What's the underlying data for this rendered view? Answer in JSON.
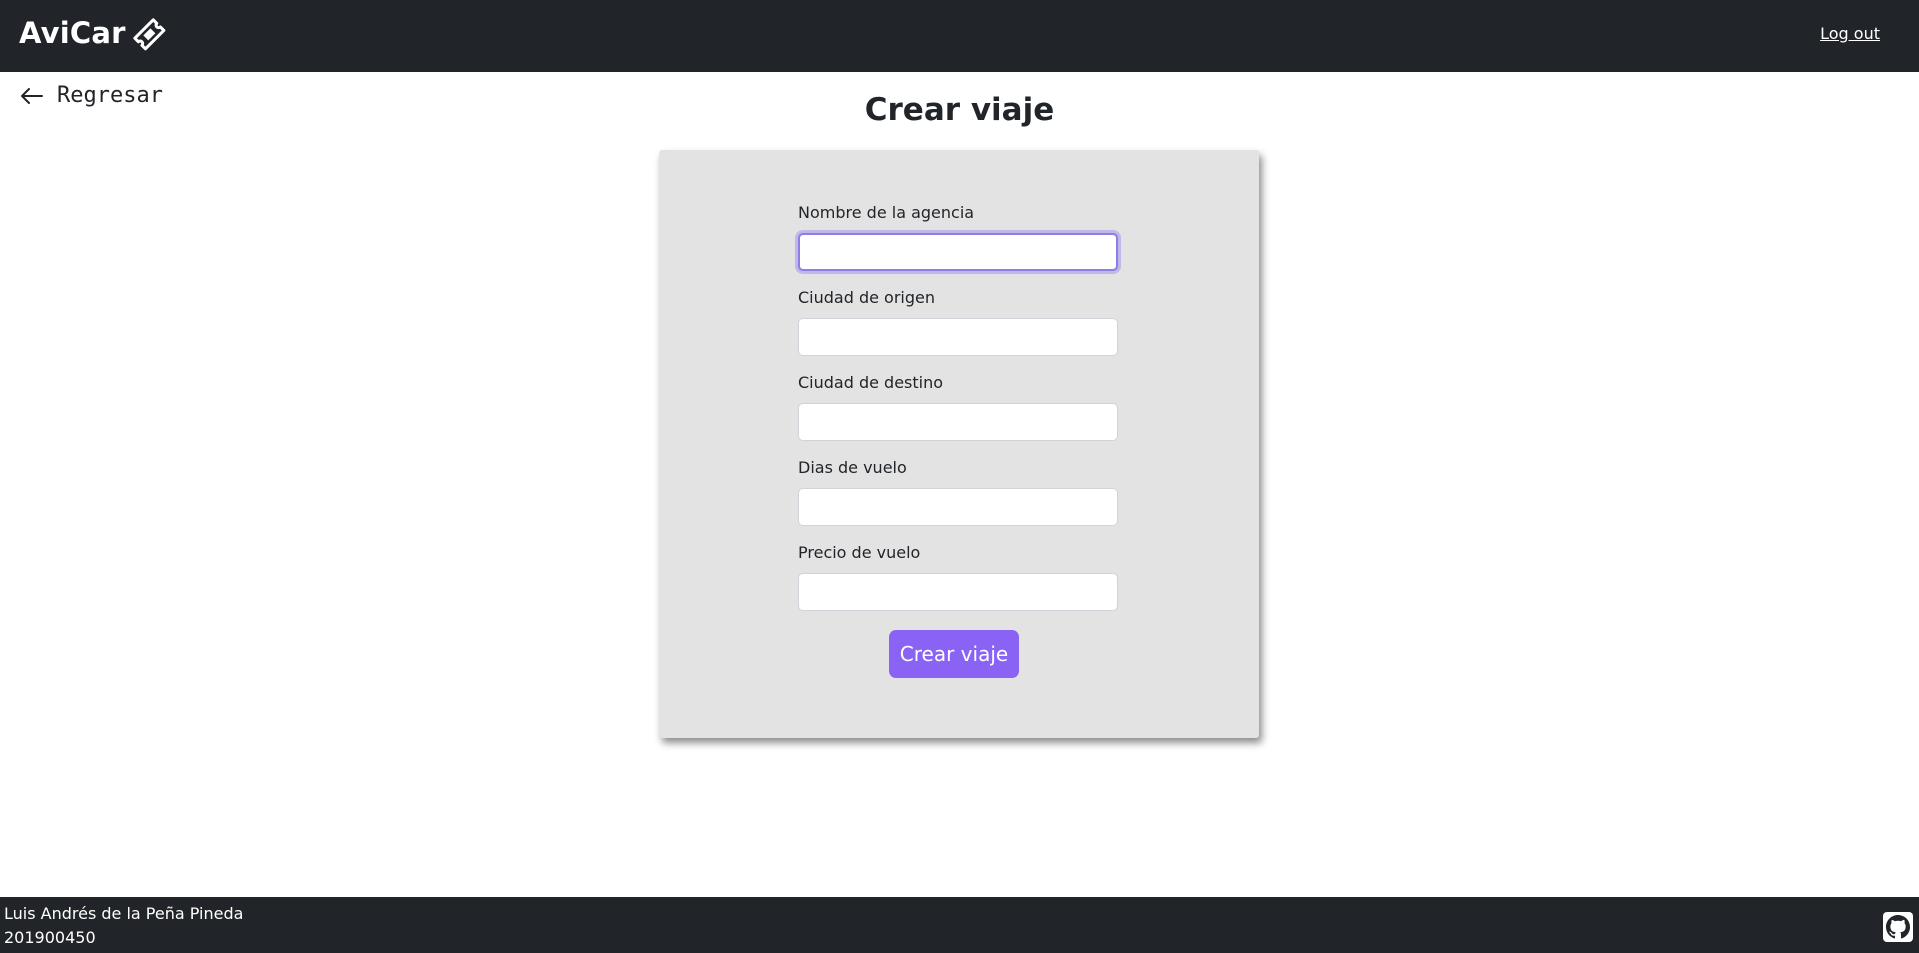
{
  "navbar": {
    "brand": "AviCar",
    "brand_icon": "ticket-icon",
    "logout_label": "Log out"
  },
  "back": {
    "icon": "arrow-left-icon",
    "label": "Regresar"
  },
  "page": {
    "title": "Crear viaje"
  },
  "form": {
    "fields": [
      {
        "label": "Nombre de la agencia",
        "value": "",
        "focused": true
      },
      {
        "label": "Ciudad de origen",
        "value": ""
      },
      {
        "label": "Ciudad de destino",
        "value": ""
      },
      {
        "label": "Dias de vuelo",
        "value": ""
      },
      {
        "label": "Precio de vuelo",
        "value": ""
      }
    ],
    "submit_label": "Crear viaje"
  },
  "footer": {
    "name": "Luis Andrés de la Peña Pineda",
    "id": "201900450",
    "github_icon": "github-icon"
  },
  "colors": {
    "navbar_bg": "#212529",
    "card_bg": "#e3e3e3",
    "accent": "#8b63f4",
    "focus_ring": "#8a7fe6"
  }
}
